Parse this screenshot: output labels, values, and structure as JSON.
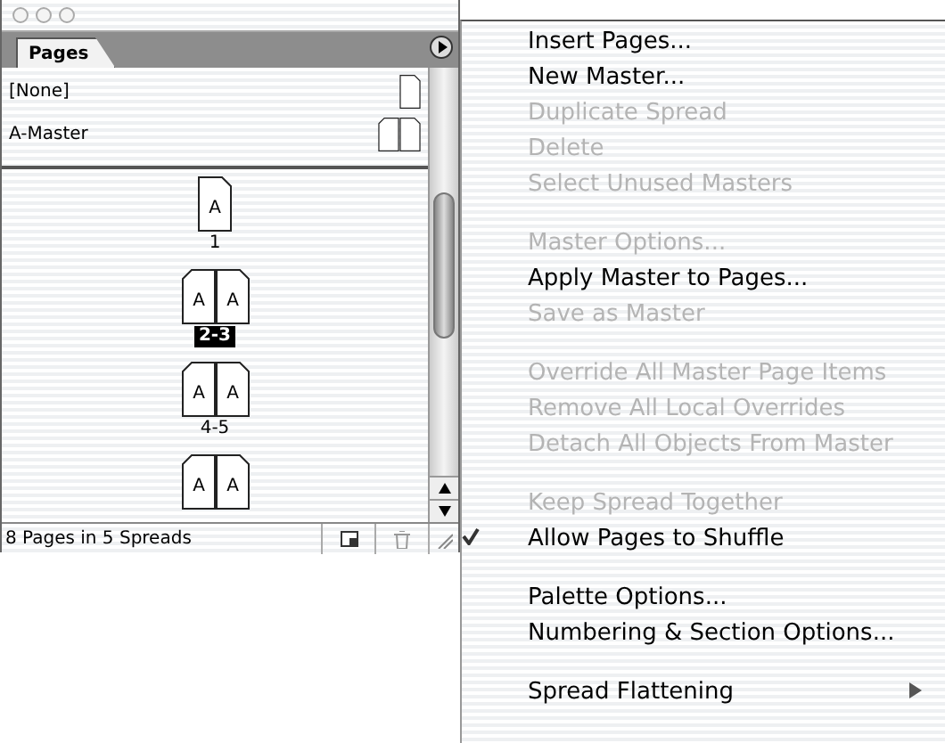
{
  "palette": {
    "tab": {
      "label": "Pages",
      "selected": true
    },
    "masters": [
      {
        "name": "[None]",
        "kind": "single"
      },
      {
        "name": "A-Master",
        "kind": "spread"
      }
    ],
    "spreads": [
      {
        "pages": [
          "A"
        ],
        "label": "1",
        "selected": false
      },
      {
        "pages": [
          "A",
          "A"
        ],
        "label": "2-3",
        "selected": true
      },
      {
        "pages": [
          "A",
          "A"
        ],
        "label": "4-5",
        "selected": false
      },
      {
        "pages": [
          "A",
          "A"
        ]
      }
    ],
    "status": "8 Pages in 5 Spreads"
  },
  "menu": [
    {
      "kind": "item",
      "label": "Insert Pages...",
      "disabled": false
    },
    {
      "kind": "item",
      "label": "New Master...",
      "disabled": false
    },
    {
      "kind": "item",
      "label": "Duplicate Spread",
      "disabled": true
    },
    {
      "kind": "item",
      "label": "Delete",
      "disabled": true
    },
    {
      "kind": "item",
      "label": "Select Unused Masters",
      "disabled": true
    },
    {
      "kind": "separator"
    },
    {
      "kind": "item",
      "label": "Master Options...",
      "disabled": true
    },
    {
      "kind": "item",
      "label": "Apply Master to Pages...",
      "disabled": false
    },
    {
      "kind": "item",
      "label": "Save as Master",
      "disabled": true
    },
    {
      "kind": "separator"
    },
    {
      "kind": "item",
      "label": "Override All Master Page Items",
      "disabled": true
    },
    {
      "kind": "item",
      "label": "Remove All Local Overrides",
      "disabled": true
    },
    {
      "kind": "item",
      "label": "Detach All Objects From Master",
      "disabled": true
    },
    {
      "kind": "separator"
    },
    {
      "kind": "item",
      "label": "Keep Spread Together",
      "disabled": true,
      "checked": false
    },
    {
      "kind": "item",
      "label": "Allow Pages to Shuffle",
      "disabled": false,
      "checked": true
    },
    {
      "kind": "separator"
    },
    {
      "kind": "item",
      "label": "Palette Options...",
      "disabled": false
    },
    {
      "kind": "item",
      "label": "Numbering & Section Options...",
      "disabled": false
    },
    {
      "kind": "separator"
    },
    {
      "kind": "item",
      "label": "Spread Flattening",
      "disabled": false,
      "submenu": true
    }
  ]
}
